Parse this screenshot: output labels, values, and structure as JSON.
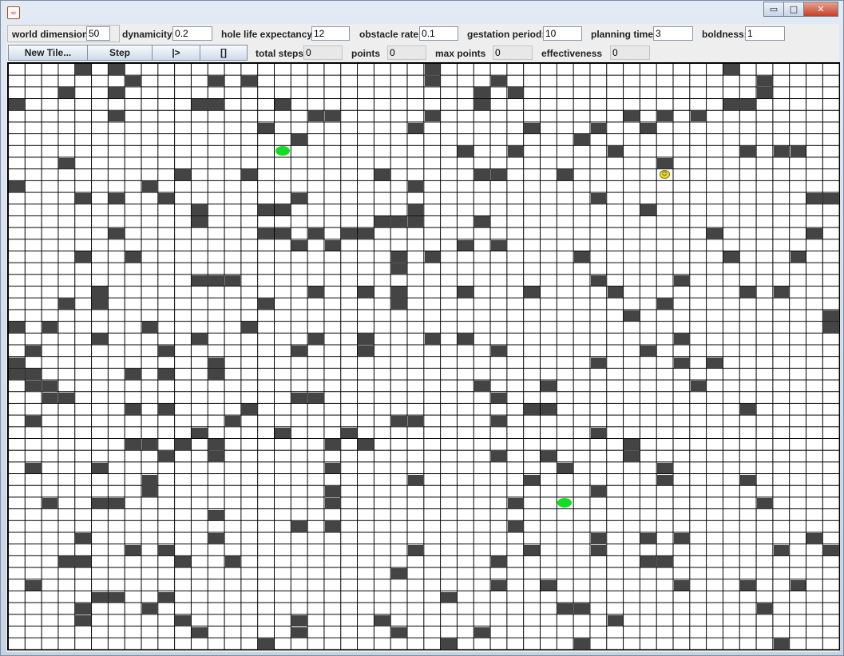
{
  "window": {
    "icon": "java-app-icon",
    "minimize": "▭",
    "maximize": "□",
    "close": "✕"
  },
  "params": {
    "world_dimension": {
      "label": "world dimension",
      "value": "50"
    },
    "dynamicity": {
      "label": "dynamicity:",
      "value": "0.2"
    },
    "hole_life": {
      "label": "hole life expectancy",
      "value": "12"
    },
    "obstacle_rate": {
      "label": "obstacle rate",
      "value": "0.1"
    },
    "gestation": {
      "label": "gestation period:",
      "value": "10"
    },
    "planning": {
      "label": "planning time:",
      "value": "3"
    },
    "boldness": {
      "label": "boldness:",
      "value": "1"
    }
  },
  "toolbar": {
    "new_tile": "New Tile...",
    "step": "Step",
    "play": "|>",
    "stop": "[]",
    "total_steps": {
      "label": "total steps",
      "value": "0"
    },
    "points": {
      "label": "points",
      "value": "0"
    },
    "max_points": {
      "label": "max points",
      "value": "0"
    },
    "effectiveness": {
      "label": "effectiveness",
      "value": "0"
    }
  },
  "grid": {
    "cols": 50,
    "rows": 50,
    "colors": {
      "obstacle": "#444444",
      "hole": "#11dd22",
      "agent": "#f2de2e",
      "empty": "#ffffff",
      "line": "#000000"
    },
    "obstacles": [
      [
        4,
        0
      ],
      [
        6,
        0
      ],
      [
        25,
        0
      ],
      [
        43,
        0
      ],
      [
        7,
        1
      ],
      [
        12,
        1
      ],
      [
        14,
        1
      ],
      [
        25,
        1
      ],
      [
        29,
        1
      ],
      [
        45,
        1
      ],
      [
        3,
        2
      ],
      [
        6,
        2
      ],
      [
        28,
        2
      ],
      [
        30,
        2
      ],
      [
        45,
        2
      ],
      [
        0,
        3
      ],
      [
        11,
        3
      ],
      [
        12,
        3
      ],
      [
        16,
        3
      ],
      [
        28,
        3
      ],
      [
        43,
        3
      ],
      [
        44,
        3
      ],
      [
        6,
        4
      ],
      [
        18,
        4
      ],
      [
        19,
        4
      ],
      [
        25,
        4
      ],
      [
        37,
        4
      ],
      [
        39,
        4
      ],
      [
        41,
        4
      ],
      [
        15,
        5
      ],
      [
        24,
        5
      ],
      [
        31,
        5
      ],
      [
        35,
        5
      ],
      [
        38,
        5
      ],
      [
        17,
        6
      ],
      [
        34,
        6
      ],
      [
        27,
        7
      ],
      [
        30,
        7
      ],
      [
        36,
        7
      ],
      [
        44,
        7
      ],
      [
        46,
        7
      ],
      [
        47,
        7
      ],
      [
        3,
        8
      ],
      [
        39,
        8
      ],
      [
        10,
        9
      ],
      [
        14,
        9
      ],
      [
        22,
        9
      ],
      [
        28,
        9
      ],
      [
        29,
        9
      ],
      [
        33,
        9
      ],
      [
        0,
        10
      ],
      [
        8,
        10
      ],
      [
        24,
        10
      ],
      [
        4,
        11
      ],
      [
        6,
        11
      ],
      [
        9,
        11
      ],
      [
        17,
        11
      ],
      [
        35,
        11
      ],
      [
        48,
        11
      ],
      [
        49,
        11
      ],
      [
        11,
        12
      ],
      [
        15,
        12
      ],
      [
        16,
        12
      ],
      [
        24,
        12
      ],
      [
        38,
        12
      ],
      [
        11,
        13
      ],
      [
        22,
        13
      ],
      [
        23,
        13
      ],
      [
        24,
        13
      ],
      [
        28,
        13
      ],
      [
        6,
        14
      ],
      [
        15,
        14
      ],
      [
        16,
        14
      ],
      [
        18,
        14
      ],
      [
        20,
        14
      ],
      [
        21,
        14
      ],
      [
        42,
        14
      ],
      [
        48,
        14
      ],
      [
        17,
        15
      ],
      [
        19,
        15
      ],
      [
        27,
        15
      ],
      [
        29,
        15
      ],
      [
        4,
        16
      ],
      [
        7,
        16
      ],
      [
        23,
        16
      ],
      [
        25,
        16
      ],
      [
        34,
        16
      ],
      [
        43,
        16
      ],
      [
        47,
        16
      ],
      [
        23,
        17
      ],
      [
        11,
        18
      ],
      [
        12,
        18
      ],
      [
        13,
        18
      ],
      [
        35,
        18
      ],
      [
        40,
        18
      ],
      [
        5,
        19
      ],
      [
        18,
        19
      ],
      [
        21,
        19
      ],
      [
        23,
        19
      ],
      [
        27,
        19
      ],
      [
        31,
        19
      ],
      [
        36,
        19
      ],
      [
        44,
        19
      ],
      [
        46,
        19
      ],
      [
        3,
        20
      ],
      [
        5,
        20
      ],
      [
        15,
        20
      ],
      [
        23,
        20
      ],
      [
        39,
        20
      ],
      [
        37,
        21
      ],
      [
        49,
        21
      ],
      [
        0,
        22
      ],
      [
        2,
        22
      ],
      [
        8,
        22
      ],
      [
        14,
        22
      ],
      [
        49,
        22
      ],
      [
        5,
        23
      ],
      [
        11,
        23
      ],
      [
        18,
        23
      ],
      [
        21,
        23
      ],
      [
        25,
        23
      ],
      [
        27,
        23
      ],
      [
        40,
        23
      ],
      [
        1,
        24
      ],
      [
        9,
        24
      ],
      [
        17,
        24
      ],
      [
        21,
        24
      ],
      [
        29,
        24
      ],
      [
        38,
        24
      ],
      [
        0,
        25
      ],
      [
        12,
        25
      ],
      [
        35,
        25
      ],
      [
        40,
        25
      ],
      [
        42,
        25
      ],
      [
        0,
        26
      ],
      [
        1,
        26
      ],
      [
        7,
        26
      ],
      [
        9,
        26
      ],
      [
        12,
        26
      ],
      [
        1,
        27
      ],
      [
        2,
        27
      ],
      [
        28,
        27
      ],
      [
        32,
        27
      ],
      [
        41,
        27
      ],
      [
        2,
        28
      ],
      [
        3,
        28
      ],
      [
        17,
        28
      ],
      [
        18,
        28
      ],
      [
        29,
        28
      ],
      [
        7,
        29
      ],
      [
        9,
        29
      ],
      [
        14,
        29
      ],
      [
        31,
        29
      ],
      [
        32,
        29
      ],
      [
        44,
        29
      ],
      [
        1,
        30
      ],
      [
        13,
        30
      ],
      [
        23,
        30
      ],
      [
        24,
        30
      ],
      [
        29,
        30
      ],
      [
        11,
        31
      ],
      [
        16,
        31
      ],
      [
        20,
        31
      ],
      [
        35,
        31
      ],
      [
        7,
        32
      ],
      [
        8,
        32
      ],
      [
        10,
        32
      ],
      [
        12,
        32
      ],
      [
        19,
        32
      ],
      [
        21,
        32
      ],
      [
        37,
        32
      ],
      [
        9,
        33
      ],
      [
        12,
        33
      ],
      [
        29,
        33
      ],
      [
        32,
        33
      ],
      [
        37,
        33
      ],
      [
        1,
        34
      ],
      [
        5,
        34
      ],
      [
        19,
        34
      ],
      [
        33,
        34
      ],
      [
        39,
        34
      ],
      [
        8,
        35
      ],
      [
        24,
        35
      ],
      [
        31,
        35
      ],
      [
        39,
        35
      ],
      [
        44,
        35
      ],
      [
        8,
        36
      ],
      [
        19,
        36
      ],
      [
        35,
        36
      ],
      [
        2,
        37
      ],
      [
        5,
        37
      ],
      [
        6,
        37
      ],
      [
        19,
        37
      ],
      [
        30,
        37
      ],
      [
        45,
        37
      ],
      [
        12,
        38
      ],
      [
        17,
        39
      ],
      [
        19,
        39
      ],
      [
        30,
        39
      ],
      [
        4,
        40
      ],
      [
        12,
        40
      ],
      [
        35,
        40
      ],
      [
        38,
        40
      ],
      [
        40,
        40
      ],
      [
        48,
        40
      ],
      [
        7,
        41
      ],
      [
        9,
        41
      ],
      [
        24,
        41
      ],
      [
        31,
        41
      ],
      [
        35,
        41
      ],
      [
        46,
        41
      ],
      [
        49,
        41
      ],
      [
        3,
        42
      ],
      [
        4,
        42
      ],
      [
        10,
        42
      ],
      [
        13,
        42
      ],
      [
        29,
        42
      ],
      [
        38,
        42
      ],
      [
        39,
        42
      ],
      [
        23,
        43
      ],
      [
        1,
        44
      ],
      [
        29,
        44
      ],
      [
        32,
        44
      ],
      [
        40,
        44
      ],
      [
        44,
        44
      ],
      [
        47,
        44
      ],
      [
        5,
        45
      ],
      [
        6,
        45
      ],
      [
        9,
        45
      ],
      [
        26,
        45
      ],
      [
        4,
        46
      ],
      [
        8,
        46
      ],
      [
        33,
        46
      ],
      [
        34,
        46
      ],
      [
        45,
        46
      ],
      [
        4,
        47
      ],
      [
        10,
        47
      ],
      [
        17,
        47
      ],
      [
        22,
        47
      ],
      [
        36,
        47
      ],
      [
        11,
        48
      ],
      [
        17,
        48
      ],
      [
        23,
        48
      ],
      [
        28,
        48
      ],
      [
        15,
        49
      ],
      [
        26,
        49
      ],
      [
        34,
        49
      ],
      [
        46,
        49
      ]
    ],
    "holes": [
      [
        16,
        7
      ],
      [
        33,
        37
      ]
    ],
    "agent": [
      39,
      9
    ]
  }
}
